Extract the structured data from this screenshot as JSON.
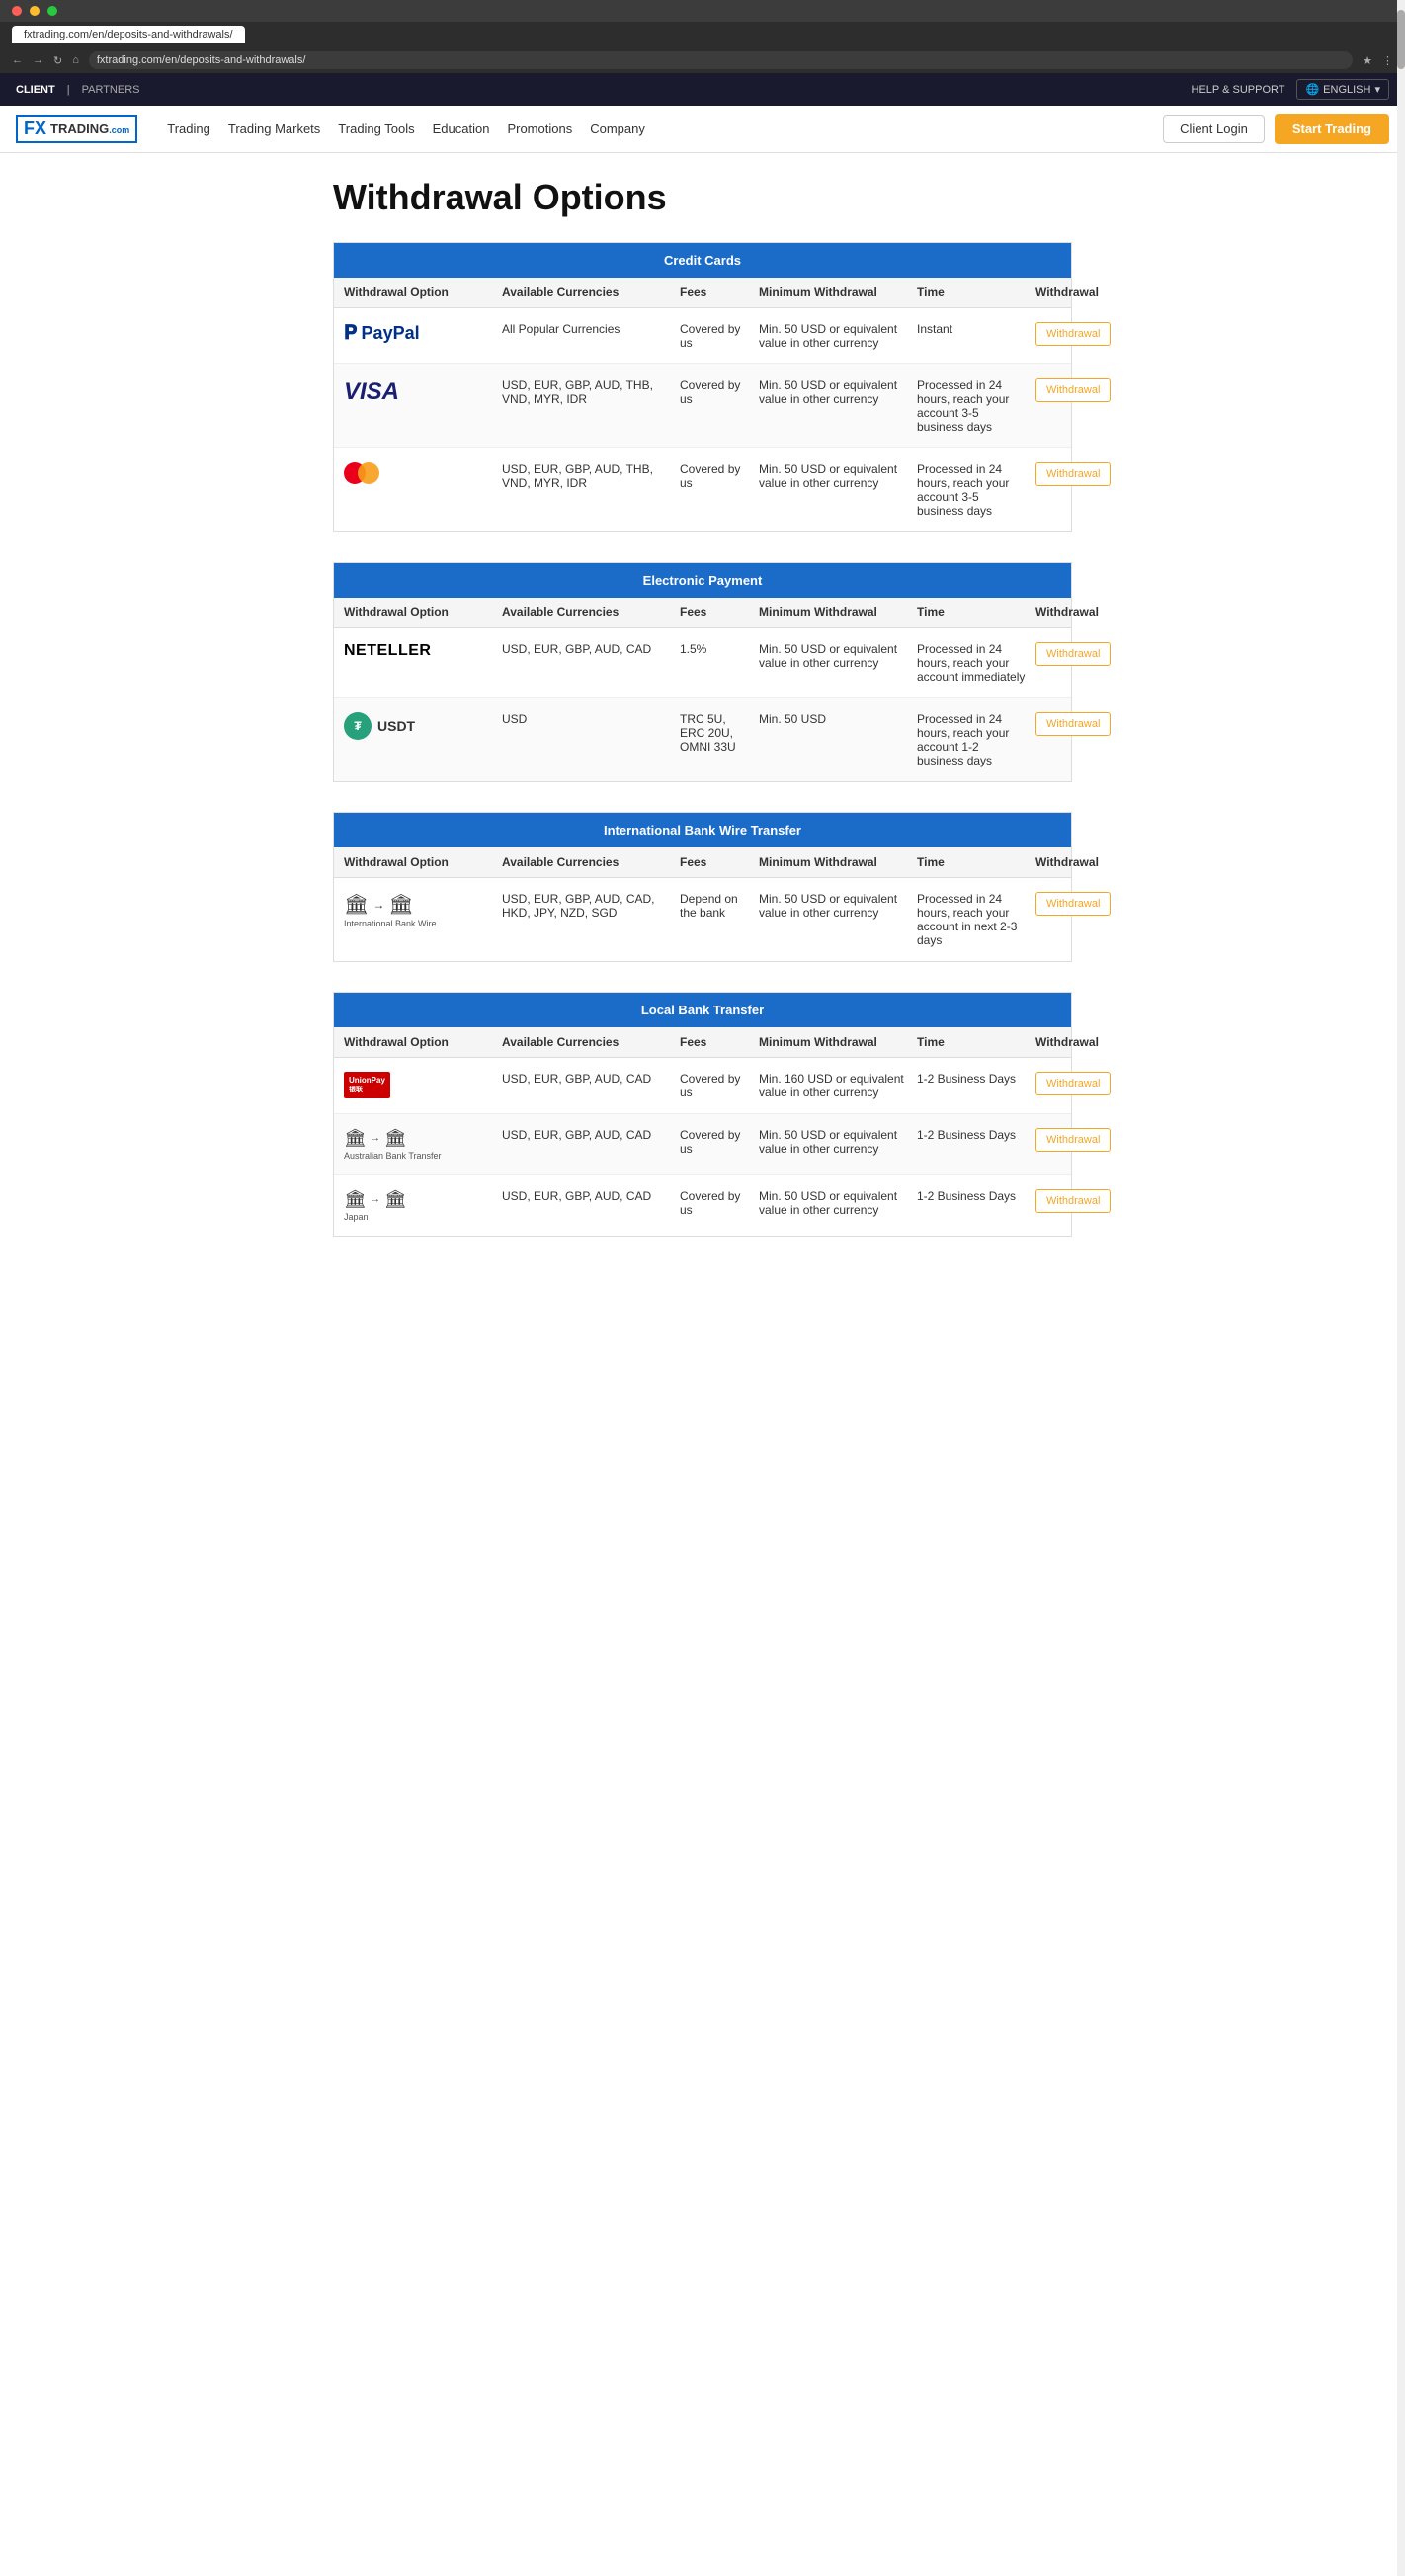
{
  "browser": {
    "url": "fxtrading.com/en/deposits-and-withdrawals/",
    "tab_label": "fxtrading.com/en/deposits-and-withdrawals/"
  },
  "top_bar": {
    "client_label": "CLIENT",
    "partners_label": "PARTNERS",
    "separator": "|",
    "help_label": "HELP & SUPPORT",
    "language_label": "ENGLISH",
    "globe_icon": "🌐"
  },
  "nav": {
    "logo_fx": "FX",
    "logo_trading": "TRADING.com",
    "links": [
      "Trading",
      "Trading Markets",
      "Trading Tools",
      "Education",
      "Promotions",
      "Company"
    ],
    "login_label": "Client Login",
    "start_label": "Start Trading"
  },
  "page": {
    "title": "Withdrawal Options"
  },
  "sections": [
    {
      "id": "credit-cards",
      "header": "Credit Cards",
      "columns": [
        "Withdrawal Option",
        "Available Currencies",
        "Fees",
        "Minimum Withdrawal",
        "Time",
        "Withdrawal"
      ],
      "rows": [
        {
          "option_type": "paypal",
          "option_label": "PayPal",
          "currencies": "All Popular Currencies",
          "fees": "Covered by us",
          "minimum": "Min. 50 USD or equivalent value in other currency",
          "time": "Instant",
          "button_label": "Withdrawal"
        },
        {
          "option_type": "visa",
          "option_label": "VISA",
          "currencies": "USD, EUR, GBP, AUD, THB, VND, MYR, IDR",
          "fees": "Covered by us",
          "minimum": "Min. 50 USD or equivalent value in other currency",
          "time": "Processed in 24 hours, reach your account 3-5 business days",
          "button_label": "Withdrawal"
        },
        {
          "option_type": "mastercard",
          "option_label": "Mastercard",
          "currencies": "USD, EUR, GBP, AUD, THB, VND, MYR, IDR",
          "fees": "Covered by us",
          "minimum": "Min. 50 USD or equivalent value in other currency",
          "time": "Processed in 24 hours, reach your account 3-5 business days",
          "button_label": "Withdrawal"
        }
      ]
    },
    {
      "id": "electronic-payment",
      "header": "Electronic Payment",
      "columns": [
        "Withdrawal Option",
        "Available Currencies",
        "Fees",
        "Minimum Withdrawal",
        "Time",
        "Withdrawal"
      ],
      "rows": [
        {
          "option_type": "neteller",
          "option_label": "NETELLER",
          "currencies": "USD, EUR, GBP, AUD, CAD",
          "fees": "1.5%",
          "minimum": "Min. 50 USD or equivalent value in other currency",
          "time": "Processed in 24 hours, reach your account immediately",
          "button_label": "Withdrawal"
        },
        {
          "option_type": "usdt",
          "option_label": "USDT",
          "currencies": "USD",
          "fees": "TRC 5U, ERC 20U, OMNI 33U",
          "minimum": "Min. 50 USD",
          "time": "Processed in 24 hours, reach your account 1-2 business days",
          "button_label": "Withdrawal"
        }
      ]
    },
    {
      "id": "international-bank",
      "header": "International Bank Wire Transfer",
      "columns": [
        "Withdrawal Option",
        "Available Currencies",
        "Fees",
        "Minimum Withdrawal",
        "Time",
        "Withdrawal"
      ],
      "rows": [
        {
          "option_type": "intl-bank",
          "option_label": "International Bank Wire",
          "currencies": "USD, EUR, GBP, AUD, CAD, HKD, JPY, NZD, SGD",
          "fees": "Depend on the bank",
          "minimum": "Min. 50 USD or equivalent value in other currency",
          "time": "Processed in 24 hours, reach your account in next 2-3 days",
          "button_label": "Withdrawal"
        }
      ]
    },
    {
      "id": "local-bank",
      "header": "Local Bank Transfer",
      "columns": [
        "Withdrawal Option",
        "Available Currencies",
        "Fees",
        "Minimum Withdrawal",
        "Time",
        "Withdrawal"
      ],
      "rows": [
        {
          "option_type": "unionpay",
          "option_label": "UnionPay",
          "currencies": "USD, EUR, GBP, AUD, CAD",
          "fees": "Covered by us",
          "minimum": "Min. 160 USD or equivalent value in other currency",
          "time": "1-2 Business Days",
          "button_label": "Withdrawal"
        },
        {
          "option_type": "aus-bank",
          "option_label": "Australian Bank Transfer",
          "currencies": "USD, EUR, GBP, AUD, CAD",
          "fees": "Covered by us",
          "minimum": "Min. 50 USD or equivalent value in other currency",
          "time": "1-2 Business Days",
          "button_label": "Withdrawal"
        },
        {
          "option_type": "japan-bank",
          "option_label": "Japan",
          "currencies": "USD, EUR, GBP, AUD, CAD",
          "fees": "Covered by us",
          "minimum": "Min. 50 USD or equivalent value in other currency",
          "time": "1-2 Business Days",
          "button_label": "Withdrawal"
        }
      ]
    }
  ]
}
